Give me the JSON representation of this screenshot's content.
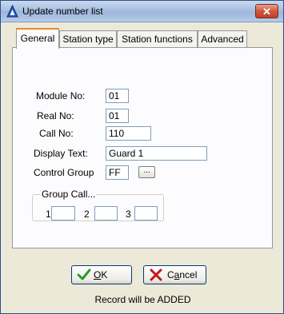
{
  "window": {
    "title": "Update number list"
  },
  "tabs": [
    {
      "label": "General",
      "active": true
    },
    {
      "label": "Station type",
      "active": false
    },
    {
      "label": "Station functions",
      "active": false
    },
    {
      "label": "Advanced",
      "active": false
    }
  ],
  "form": {
    "module_no": {
      "label": "Module No:",
      "value": "01"
    },
    "real_no": {
      "label": "Real No:",
      "value": "01"
    },
    "call_no": {
      "label": "Call No:",
      "value": "110"
    },
    "display_text": {
      "label": "Display Text:",
      "value": "Guard 1"
    },
    "control_group": {
      "label": "Control Group",
      "value": "FF",
      "browse_label": "..."
    }
  },
  "group_call": {
    "legend": "Group Call...",
    "fields": [
      {
        "label": "1",
        "value": ""
      },
      {
        "label": "2",
        "value": ""
      },
      {
        "label": "3",
        "value": ""
      }
    ]
  },
  "buttons": {
    "ok": {
      "mnemonic": "O",
      "rest": "K"
    },
    "cancel": {
      "lead": "C",
      "mnemonic": "a",
      "rest": "ncel"
    }
  },
  "status": "Record will be ADDED",
  "colors": {
    "active_tab_accent": "#e68b2c",
    "close_button": "#c0402a",
    "ok_check": "#2e9b2e",
    "cancel_x": "#c4161c"
  }
}
